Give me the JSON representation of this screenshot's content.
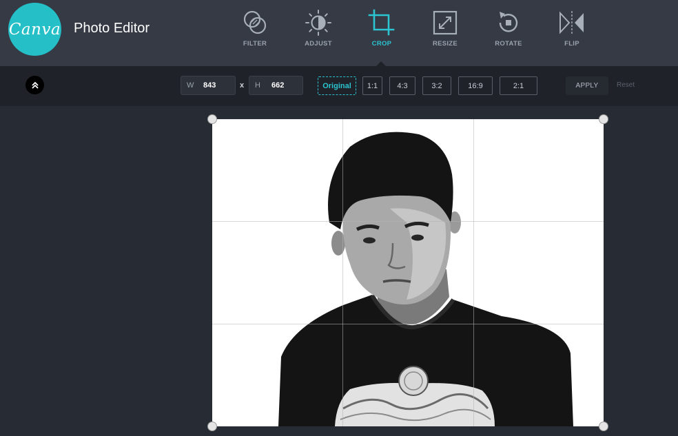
{
  "app": {
    "logo_text": "Canva",
    "title": "Photo Editor"
  },
  "tools": [
    {
      "label": "FILTER",
      "icon": "filter-icon"
    },
    {
      "label": "ADJUST",
      "icon": "adjust-icon"
    },
    {
      "label": "CROP",
      "icon": "crop-icon",
      "active": true
    },
    {
      "label": "RESIZE",
      "icon": "resize-icon"
    },
    {
      "label": "ROTATE",
      "icon": "rotate-icon"
    },
    {
      "label": "FLIP",
      "icon": "flip-icon"
    }
  ],
  "crop": {
    "width_label": "W",
    "width_value": "843",
    "times": "x",
    "height_label": "H",
    "height_value": "662",
    "ratios": [
      "Original",
      "1:1",
      "4:3",
      "3:2",
      "16:9",
      "2:1"
    ],
    "active_ratio": "Original",
    "apply_label": "APPLY",
    "reset_label": "Reset"
  },
  "colors": {
    "accent": "#2bc4d0",
    "logo": "#25bfc8",
    "header_bg": "#353a45",
    "toolbar_bg": "#1f2228",
    "canvas_bg": "#272b33"
  },
  "icons": {
    "collapse": "chevron-double-up-icon"
  }
}
